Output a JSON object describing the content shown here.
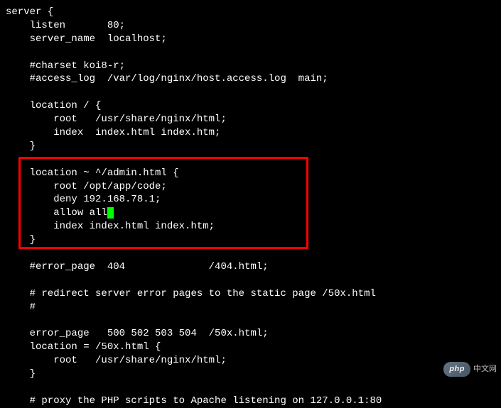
{
  "code": {
    "line1": "server {",
    "line2": "    listen       80;",
    "line3": "    server_name  localhost;",
    "line4": "",
    "line5": "    #charset koi8-r;",
    "line6": "    #access_log  /var/log/nginx/host.access.log  main;",
    "line7": "",
    "line8": "    location / {",
    "line9": "        root   /usr/share/nginx/html;",
    "line10": "        index  index.html index.htm;",
    "line11": "    }",
    "line12": "",
    "line13": "    location ~ ^/admin.html {",
    "line14": "        root /opt/app/code;",
    "line15": "        deny 192.168.78.1;",
    "line16a": "        allow all",
    "line16b": "",
    "line17": "        index index.html index.htm;",
    "line18": "    }",
    "line19": "",
    "line20": "    #error_page  404              /404.html;",
    "line21": "",
    "line22": "    # redirect server error pages to the static page /50x.html",
    "line23": "    #",
    "line24": "",
    "line25": "    error_page   500 502 503 504  /50x.html;",
    "line26": "    location = /50x.html {",
    "line27": "        root   /usr/share/nginx/html;",
    "line28": "    }",
    "line29": "",
    "line30": "    # proxy the PHP scripts to Apache listening on 127.0.0.1:80"
  },
  "watermark": {
    "badge": "php",
    "text": "中文网"
  }
}
